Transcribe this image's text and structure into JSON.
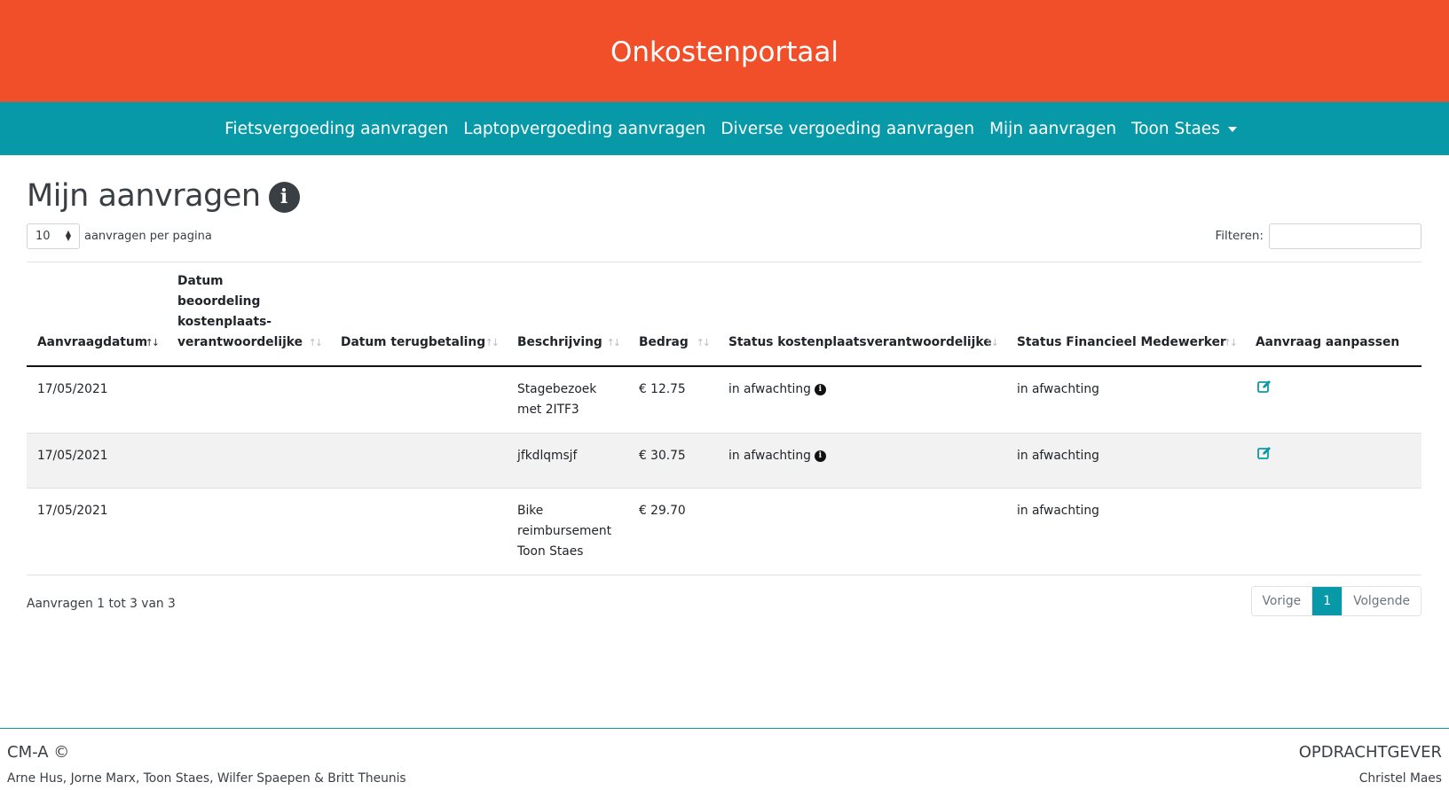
{
  "header": {
    "title": "Onkostenportaal"
  },
  "nav": {
    "items": [
      "Fietsvergoeding aanvragen",
      "Laptopvergoeding aanvragen",
      "Diverse vergoeding aanvragen",
      "Mijn aanvragen"
    ],
    "user": "Toon Staes"
  },
  "page": {
    "title": "Mijn aanvragen",
    "length_value": "10",
    "length_label": "aanvragen per pagina",
    "filter_label": "Filteren:",
    "filter_value": ""
  },
  "table": {
    "columns": [
      "Aanvraagdatum",
      "Datum beoordeling kostenplaats-verantwoordelijke",
      "Datum terugbetaling",
      "Beschrijving",
      "Bedrag",
      "Status kostenplaatsverantwoordelijke",
      "Status Financieel Medewerker",
      "Aanvraag aanpassen"
    ],
    "rows": [
      {
        "datum": "17/05/2021",
        "beoordeling": "",
        "terugbetaling": "",
        "beschrijving": "Stagebezoek met 2ITF3",
        "bedrag": "€ 12.75",
        "status_kpv": "in afwachting",
        "status_fin": "in afwachting"
      },
      {
        "datum": "17/05/2021",
        "beoordeling": "",
        "terugbetaling": "",
        "beschrijving": "jfkdlqmsjf",
        "bedrag": "€ 30.75",
        "status_kpv": "in afwachting",
        "status_fin": "in afwachting"
      },
      {
        "datum": "17/05/2021",
        "beoordeling": "",
        "terugbetaling": "",
        "beschrijving": "Bike reimbursement Toon Staes",
        "bedrag": "€ 29.70",
        "status_kpv": "",
        "status_fin": "in afwachting"
      }
    ]
  },
  "table_footer": {
    "info": "Aanvragen 1 tot 3 van 3",
    "prev": "Vorige",
    "page": "1",
    "next": "Volgende"
  },
  "footer": {
    "brand": "CM-A ©",
    "authors": "Arne Hus, Jorne Marx, Toon Staes, Wilfer Spaepen & Britt Theunis",
    "client_label": "OPDRACHTGEVER",
    "client_name": "Christel Maes"
  },
  "colors": {
    "header": "#f14e2a",
    "nav": "#0899a8",
    "accent": "#0899a8"
  },
  "icons": {
    "info": "info-circle-icon",
    "edit": "edit-icon",
    "sort": "sort-icon",
    "caret": "chevron-down-icon"
  }
}
